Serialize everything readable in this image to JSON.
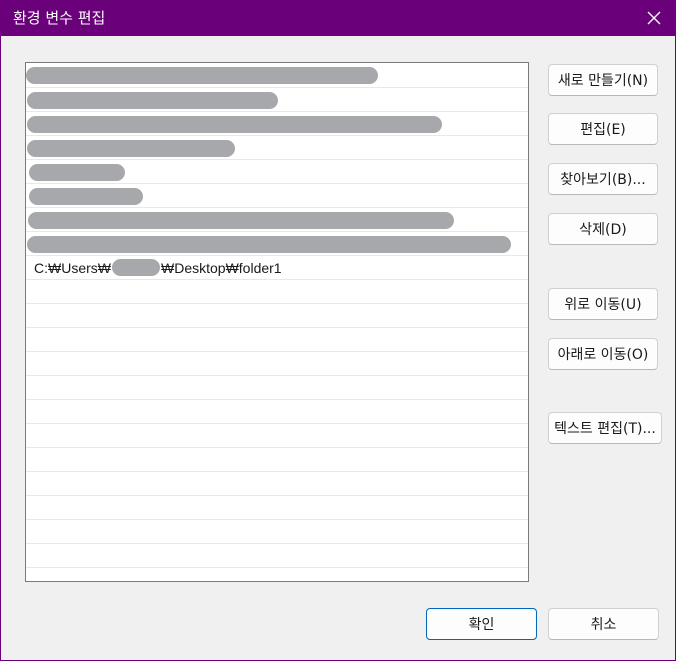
{
  "window": {
    "title": "환경 변수 편집"
  },
  "path_list": {
    "visible_path": {
      "prefix": "C:₩Users₩",
      "suffix": "₩Desktop₩folder1"
    }
  },
  "buttons": {
    "new": "새로 만들기(N)",
    "edit": "편집(E)",
    "browse": "찾아보기(B)...",
    "delete": "삭제(D)",
    "move_up": "위로 이동(U)",
    "move_down": "아래로 이동(O)",
    "edit_text": "텍스트 편집(T)...",
    "ok": "확인",
    "cancel": "취소"
  },
  "colors": {
    "titlebar": "#6b007b",
    "redaction": "#a7a8ab",
    "primary_border": "#0067c0"
  }
}
